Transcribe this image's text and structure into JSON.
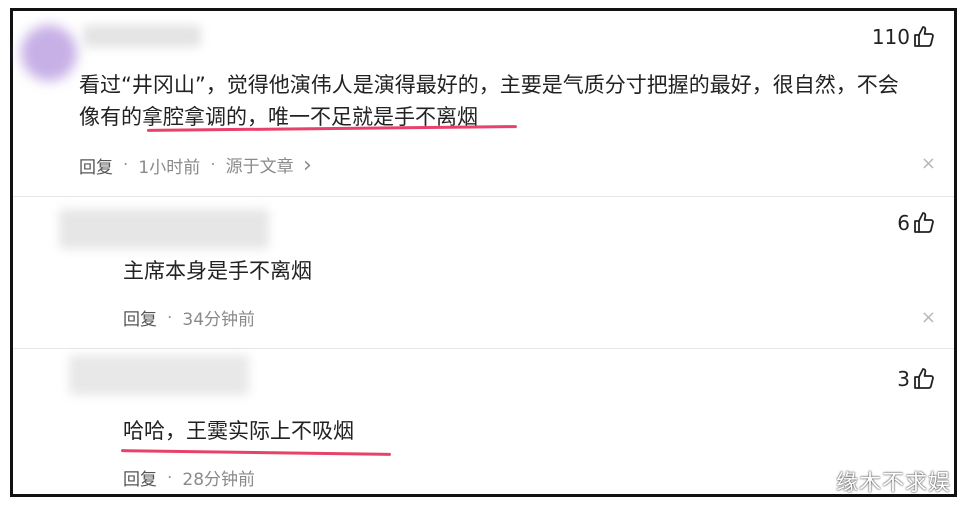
{
  "comments": [
    {
      "likes": "110",
      "text_line1": "看过“井冈山”，觉得他演伟人是演得最好的，主要是气质分寸把握的最好，很自然，不会",
      "text_line2": "像有的拿腔拿调的，唯一不足就是手不离烟",
      "reply_label": "回复",
      "time": "1小时前",
      "source": "源于文章",
      "source_chevron": "›",
      "close": "×"
    },
    {
      "likes": "6",
      "text": "主席本身是手不离烟",
      "reply_label": "回复",
      "time": "34分钟前",
      "close": "×"
    },
    {
      "likes": "3",
      "text": "哈哈，王霙实际上不吸烟",
      "reply_label": "回复",
      "time": "28分钟前"
    }
  ],
  "separator": "·",
  "watermark": "缘木不求娱",
  "colors": {
    "highlight": "#e8416a",
    "border": "#111111"
  },
  "icons": {
    "like": "thumbs-up-icon",
    "close": "close-icon",
    "chevron": "chevron-right-icon"
  }
}
